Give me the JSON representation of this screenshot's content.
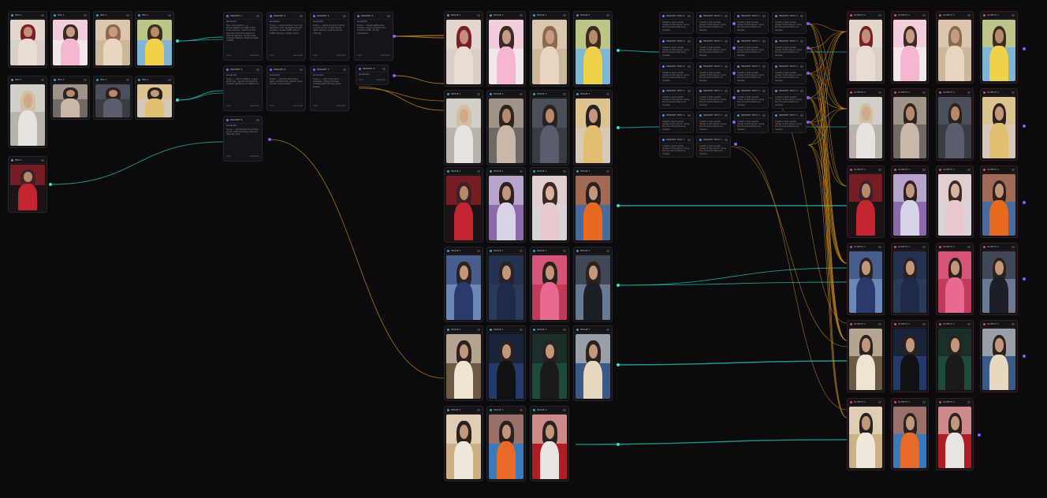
{
  "app": {
    "name": "node workflow canvas",
    "colors": {
      "background": "#0b0b0d",
      "node_bg": "#141416",
      "wire_image": "#26b3a5",
      "wire_text": "#c98a1e",
      "port_image": "#2ee6c7",
      "port_text": "#8a5cff",
      "output_header": "#d0506a"
    }
  },
  "groups": {
    "reference_images": {
      "node_title": "IMG 1",
      "icon": "image-icon"
    },
    "prompt_generators": {
      "node_title": "PROMPT 1",
      "subtitle": "Generate",
      "icon": "sparkle-icon"
    },
    "batch_images": {
      "node_title": "IMAGE 1",
      "icon": "image-icon"
    },
    "prompt_texts": {
      "node_title": "PROMPT TEXT 1",
      "body": "Create a high quality image of the person using the provided reference images.",
      "icon": "text-icon"
    },
    "final_outputs": {
      "node_title": "OUTPUT 1",
      "icon": "image-icon"
    }
  },
  "generator_nodes": [
    {
      "title": "PROMPT 1",
      "label": "Generate",
      "body": "Hair Composition — a photorealistic portrait of the same woman, matching face and hair from the reference, natural lighting, candid pose, soft skin texture, shallow depth of field.",
      "foot_left": "Auto",
      "foot_right": "Generate"
    },
    {
      "title": "PROMPT 2",
      "label": "Generate",
      "body": "Scene — same woman in a cozy bedroom, soft daylight through window, casual outfit, phone selfie framing, realistic grain.",
      "foot_left": "Auto",
      "foot_right": "Generate"
    },
    {
      "title": "PROMPT 3",
      "label": "Generate",
      "body": "Scene — same woman holding a product box, bright studio light, smiling, vertical phone framing.",
      "foot_left": "Auto",
      "foot_right": "Generate"
    },
    {
      "title": "PROMPT 4",
      "label": "Generate",
      "body": "Scene — travel selfie at an outdoor venue, golden hour, colorful outfit, candid expression.",
      "foot_left": "Auto",
      "foot_right": "Generate"
    },
    {
      "title": "PROMPT 5",
      "label": "Generate",
      "body": "Scene — mirror selfie in a gym, white top, neutral background, realistic lighting and reflections.",
      "foot_left": "Auto",
      "foot_right": "Generate"
    },
    {
      "title": "PROMPT 6",
      "label": "Generate",
      "body": "Scene — pink themed store aisle, branded tee, playful pose, vibrant color palette.",
      "foot_left": "Auto",
      "foot_right": "Generate"
    },
    {
      "title": "PROMPT 7",
      "label": "Generate",
      "body": "Scene — airport terminal walkway, rolling suitcase, evening light through glass facade.",
      "foot_left": "Auto",
      "foot_right": "Generate"
    },
    {
      "title": "PROMPT 8",
      "label": "Generate",
      "body": "Scene — landmarks around the world, selfie framing, dusk sky, natural tones.",
      "foot_left": "Auto",
      "foot_right": "Generate"
    },
    {
      "title": "PROMPT 9",
      "label": "Generate",
      "body": "Scene — podcast studio with red wall and microphone, headphones, talk show vibe.",
      "foot_left": "Auto",
      "foot_right": "Generate"
    }
  ]
}
